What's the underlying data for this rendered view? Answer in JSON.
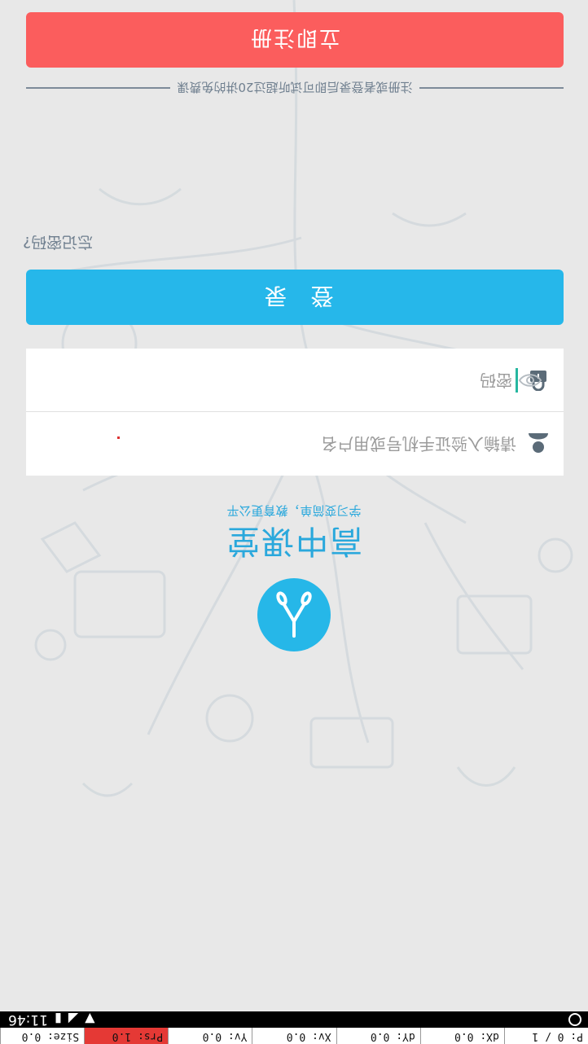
{
  "status_bar": {
    "time": "11:46",
    "pointer": {
      "p": "P: 0 / 1",
      "dx": "dX: 0.0",
      "dy": "dY: 0.0",
      "xv": "Xv: 0.0",
      "yv": "Yv: 0.0",
      "prs": "Prs: 1.0",
      "size": "Size: 0.0"
    }
  },
  "brand": {
    "title": "高中课堂",
    "slogan": "学习变简单，教育更公平",
    "logo_icon": "tweezers-logo-icon",
    "color": "#26b7e8"
  },
  "form": {
    "username_placeholder": "请输入验证手机号或用户名",
    "password_placeholder": "密码",
    "username_icon": "user-icon",
    "password_icon": "lock-icon",
    "toggle_icon": "eye-icon"
  },
  "actions": {
    "login_label": "登 录",
    "forgot_label": "忘记密码?",
    "divider_text": "注册或者登录后即可试听超过20讲的免费课",
    "register_label": "立即注册",
    "login_color": "#26b7ea",
    "register_color": "#fb5d5d"
  }
}
